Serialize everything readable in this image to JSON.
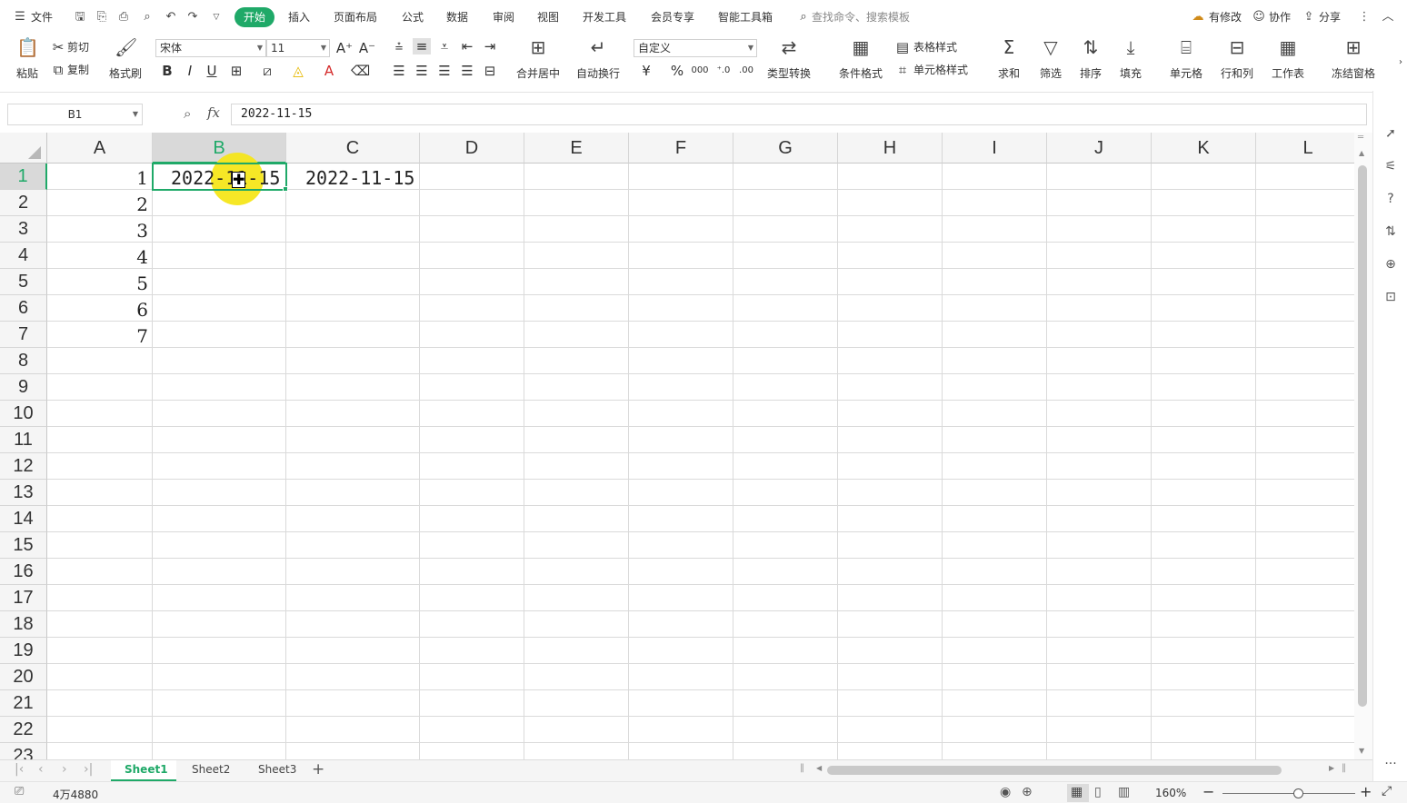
{
  "menubar": {
    "file_label": "文件",
    "tabs": [
      "开始",
      "插入",
      "页面布局",
      "公式",
      "数据",
      "审阅",
      "视图",
      "开发工具",
      "会员专享",
      "智能工具箱"
    ],
    "active_tab": "开始",
    "search_placeholder": "查找命令、搜索模板",
    "modified_label": "有修改",
    "collab_label": "协作",
    "share_label": "分享"
  },
  "ribbon": {
    "paste": "粘贴",
    "cut": "剪切",
    "copy": "复制",
    "format_painter": "格式刷",
    "font_name": "宋体",
    "font_size": "11",
    "merge_center": "合并居中",
    "wrap_text": "自动换行",
    "number_format": "自定义",
    "type_convert": "类型转换",
    "cond_format": "条件格式",
    "table_style": "表格样式",
    "cell_style": "单元格样式",
    "sum": "求和",
    "filter": "筛选",
    "sort": "排序",
    "fill": "填充",
    "cell": "单元格",
    "row_col": "行和列",
    "worksheet": "工作表",
    "freeze": "冻结窗格"
  },
  "formula_bar": {
    "name_box": "B1",
    "fx_label": "fx",
    "value": "2022-11-15"
  },
  "grid": {
    "columns": [
      "A",
      "B",
      "C",
      "D",
      "E",
      "F",
      "G",
      "H",
      "I",
      "J",
      "K",
      "L"
    ],
    "rows": [
      "1",
      "2",
      "3",
      "4",
      "5",
      "6",
      "7",
      "8",
      "9",
      "10",
      "11",
      "12",
      "13",
      "14",
      "15",
      "16",
      "17",
      "18",
      "19",
      "20",
      "21",
      "22",
      "23"
    ],
    "col_a_values": [
      "1",
      "2",
      "3",
      "4",
      "5",
      "6",
      "7"
    ],
    "b1": "2022-11-15",
    "c1": "2022-11-15",
    "selected_cell": "B1"
  },
  "sheets": [
    "Sheet1",
    "Sheet2",
    "Sheet3"
  ],
  "active_sheet": "Sheet1",
  "status": {
    "count": "4万4880",
    "zoom": "160%"
  },
  "colors": {
    "accent": "#1fa968",
    "highlight": "#f5e61a"
  }
}
